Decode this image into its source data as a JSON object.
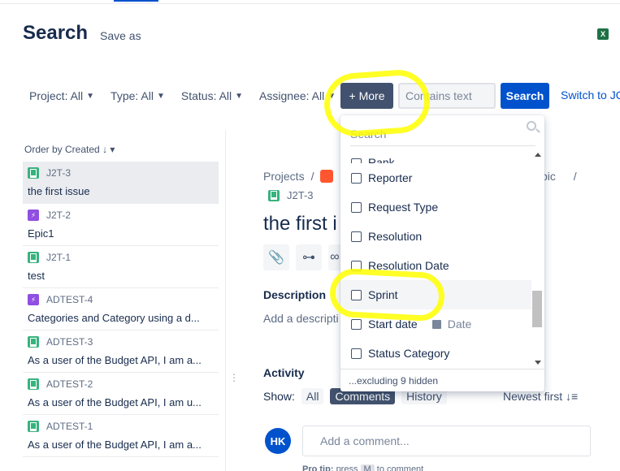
{
  "header": {
    "title": "Search",
    "save_as": "Save as"
  },
  "filters": {
    "project": "Project: All",
    "type": "Type: All",
    "status": "Status: All",
    "assignee": "Assignee: All",
    "more": "+ More",
    "contains_placeholder": "Contains text",
    "search": "Search",
    "switch": "Switch to JQL"
  },
  "list": {
    "order_by": "Order by Created",
    "issues": [
      {
        "key": "J2T-3",
        "summary": "the first issue",
        "type": "story"
      },
      {
        "key": "J2T-2",
        "summary": "Epic1",
        "type": "epic"
      },
      {
        "key": "J2T-1",
        "summary": "test",
        "type": "story"
      },
      {
        "key": "ADTEST-4",
        "summary": "Categories and Category using a d...",
        "type": "epic"
      },
      {
        "key": "ADTEST-3",
        "summary": "As a user of the Budget API, I am a...",
        "type": "story"
      },
      {
        "key": "ADTEST-2",
        "summary": "As a user of the Budget API, I am u...",
        "type": "story"
      },
      {
        "key": "ADTEST-1",
        "summary": "As a user of the Budget API, I am a...",
        "type": "story"
      }
    ]
  },
  "detail": {
    "projects": "Projects",
    "slash": "/",
    "epic_fragment": "pic",
    "key": "J2T-3",
    "title": "the first i",
    "description_label": "Description",
    "description_placeholder": "Add a descripti",
    "activity_label": "Activity",
    "show_label": "Show:",
    "show_all": "All",
    "show_comments": "Comments",
    "show_history": "History",
    "sort": "Newest first",
    "avatar_initials": "HK",
    "comment_placeholder": "Add a comment...",
    "protip_prefix": "Pro tip:",
    "protip_press": "press",
    "protip_key": "M",
    "protip_suffix": "to comment"
  },
  "dropdown": {
    "search_placeholder": "Search",
    "items": {
      "rank": "Rank",
      "reporter": "Reporter",
      "request_type": "Request Type",
      "resolution": "Resolution",
      "resolution_date": "Resolution Date",
      "sprint": "Sprint",
      "start_date": "Start date",
      "start_date_suffix": "Date",
      "status_category": "Status Category"
    },
    "footer": "...excluding 9 hidden"
  },
  "colors": {
    "primary": "#0052cc",
    "more_button": "#42526e",
    "highlight": "#ffff00"
  }
}
